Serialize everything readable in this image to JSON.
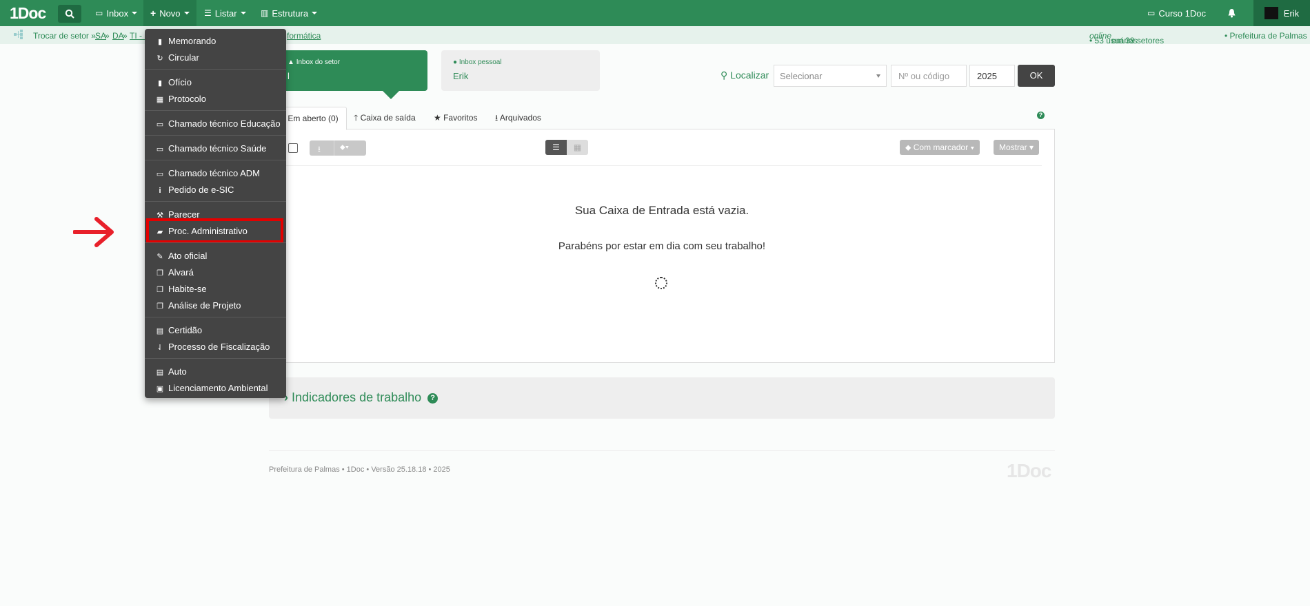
{
  "navbar": {
    "brand": "1Doc",
    "inbox_label": "Inbox",
    "novo_label": "Novo",
    "listar_label": "Listar",
    "estrutura_label": "Estrutura",
    "curso_label": "Curso 1Doc",
    "user_name": "Erik"
  },
  "breadcrumb": {
    "trocar": "Trocar de setor »",
    "sa": "SA",
    "sep1": " » ",
    "da": "DA",
    "sep2": " » ",
    "ti": "TI - I",
    "tail": "formática",
    "users_prefix": "• 53 usuários ",
    "users_online": "online",
    "users_suffix": " em 38 setores",
    "prefeitura": "• Prefeitura de Palmas"
  },
  "inbox": {
    "setor_label": "Inbox do setor",
    "setor_value": "l",
    "pessoal_label": "Inbox pessoal",
    "pessoal_value": "Erik"
  },
  "search": {
    "localizar": "Localizar",
    "select_value": "Selecionar",
    "number_placeholder": "Nº ou código",
    "year": "2025",
    "ok": "OK"
  },
  "tabs": {
    "em_aberto": "Em aberto (0)",
    "caixa_saida": "Caixa de saída",
    "favoritos": "Favoritos",
    "arquivados": "Arquivados"
  },
  "toolbar": {
    "com_marcador": "Com marcador",
    "mostrar": "Mostrar"
  },
  "empty": {
    "title": "Sua Caixa de Entrada está vazia.",
    "subtitle": "Parabéns por estar em dia com seu trabalho!"
  },
  "indicators": {
    "title": "Indicadores de trabalho"
  },
  "footer": {
    "text": "Prefeitura de Palmas • 1Doc • Versão 25.18.18 • 2025",
    "logo": "1Doc"
  },
  "novo_menu": {
    "items": [
      {
        "label": "Memorando",
        "icon": "file-icon"
      },
      {
        "label": "Circular",
        "icon": "refresh-icon"
      },
      {
        "label": "Ofício",
        "icon": "file-icon"
      },
      {
        "label": "Protocolo",
        "icon": "grid-icon"
      },
      {
        "label": "Chamado técnico Educação",
        "icon": "keyboard-icon"
      },
      {
        "label": "Chamado técnico Saúde",
        "icon": "keyboard-icon"
      },
      {
        "label": "Chamado técnico ADM",
        "icon": "keyboard-icon"
      },
      {
        "label": "Pedido de e-SIC",
        "icon": "info-icon"
      },
      {
        "label": "Parecer",
        "icon": "gavel-icon"
      },
      {
        "label": "Proc. Administrativo",
        "icon": "folder-open-icon"
      },
      {
        "label": "Ato oficial",
        "icon": "edit-icon"
      },
      {
        "label": "Alvará",
        "icon": "copy-icon"
      },
      {
        "label": "Habite-se",
        "icon": "copy-icon"
      },
      {
        "label": "Análise de Projeto",
        "icon": "copy-icon"
      },
      {
        "label": "Certidão",
        "icon": "archive-icon"
      },
      {
        "label": "Processo de Fiscalização",
        "icon": "sort-icon"
      },
      {
        "label": "Auto",
        "icon": "archive-icon"
      },
      {
        "label": "Licenciamento Ambiental",
        "icon": "picture-icon"
      }
    ]
  },
  "colors": {
    "brand_green": "#2e8b57",
    "dropdown_bg": "#444444",
    "highlight_red": "#e30000"
  }
}
